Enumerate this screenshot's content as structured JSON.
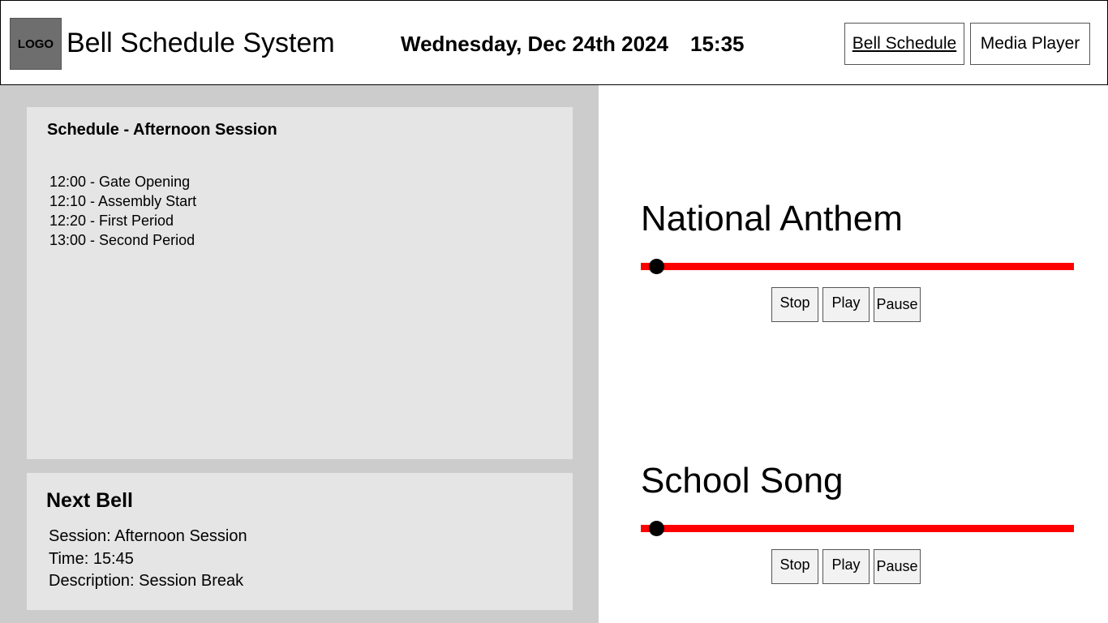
{
  "header": {
    "logo_text": "LOGO",
    "app_title": "Bell Schedule System",
    "date": "Wednesday, Dec 24th 2024",
    "time": "15:35",
    "nav": {
      "bell_schedule": "Bell Schedule",
      "media_player": "Media Player"
    }
  },
  "schedule": {
    "title": "Schedule - Afternoon Session",
    "items": [
      "12:00 - Gate Opening",
      "12:10 - Assembly Start",
      "12:20 - First Period",
      "13:00 - Second Period"
    ]
  },
  "next_bell": {
    "title": "Next Bell",
    "session": "Session: Afternoon Session",
    "time": "Time: 15:45",
    "description": "Description: Session Break"
  },
  "tracks": [
    {
      "title": "National Anthem",
      "progress": 0.035,
      "stop": "Stop",
      "play": "Play",
      "pause": "Pause"
    },
    {
      "title": "School Song",
      "progress": 0.035,
      "stop": "Stop",
      "play": "Play",
      "pause": "Pause"
    }
  ],
  "colors": {
    "progress_bar": "#ff0000",
    "panel_bg": "#cccccc",
    "card_bg": "#e5e5e5"
  }
}
